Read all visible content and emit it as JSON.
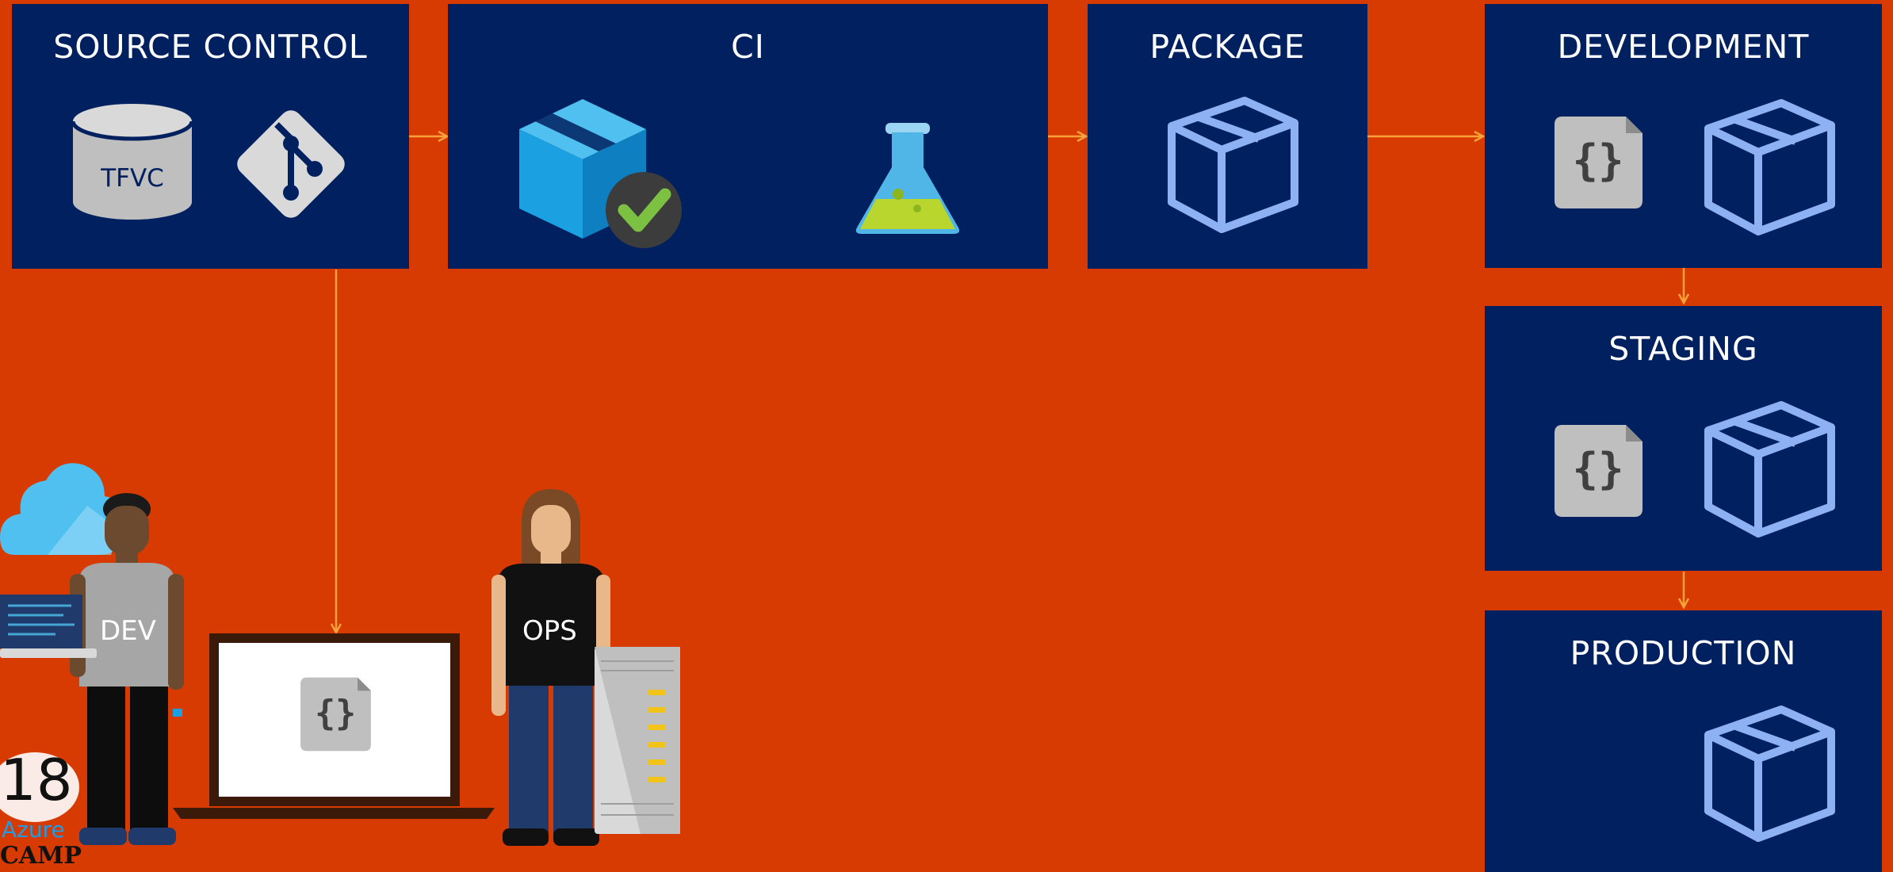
{
  "stages": {
    "source_control": {
      "title": "SOURCE CONTROL",
      "tfvc_label": "TFVC"
    },
    "ci": {
      "title": "CI"
    },
    "package": {
      "title": "PACKAGE"
    },
    "development": {
      "title": "DEVELOPMENT"
    },
    "staging": {
      "title": "STAGING"
    },
    "production": {
      "title": "PRODUCTION"
    }
  },
  "people": {
    "dev_label": "DEV",
    "ops_label": "OPS"
  },
  "logo": {
    "number": "18",
    "azure": "Azure",
    "camp": "CAMP"
  },
  "icons": {
    "database": "database-icon",
    "git": "git-icon",
    "build": "build-package-check-icon",
    "test": "flask-icon",
    "package": "package-box-icon",
    "config": "code-file-icon",
    "cloud": "cloud-icon",
    "server": "server-icon",
    "laptop": "laptop-icon"
  },
  "colors": {
    "background": "#D83B01",
    "stage_box": "#012060",
    "arrow": "#F7A23A",
    "package_outline": "#8DB1F2",
    "build_blue": "#1BA1E2",
    "check_green": "#7DC142"
  }
}
